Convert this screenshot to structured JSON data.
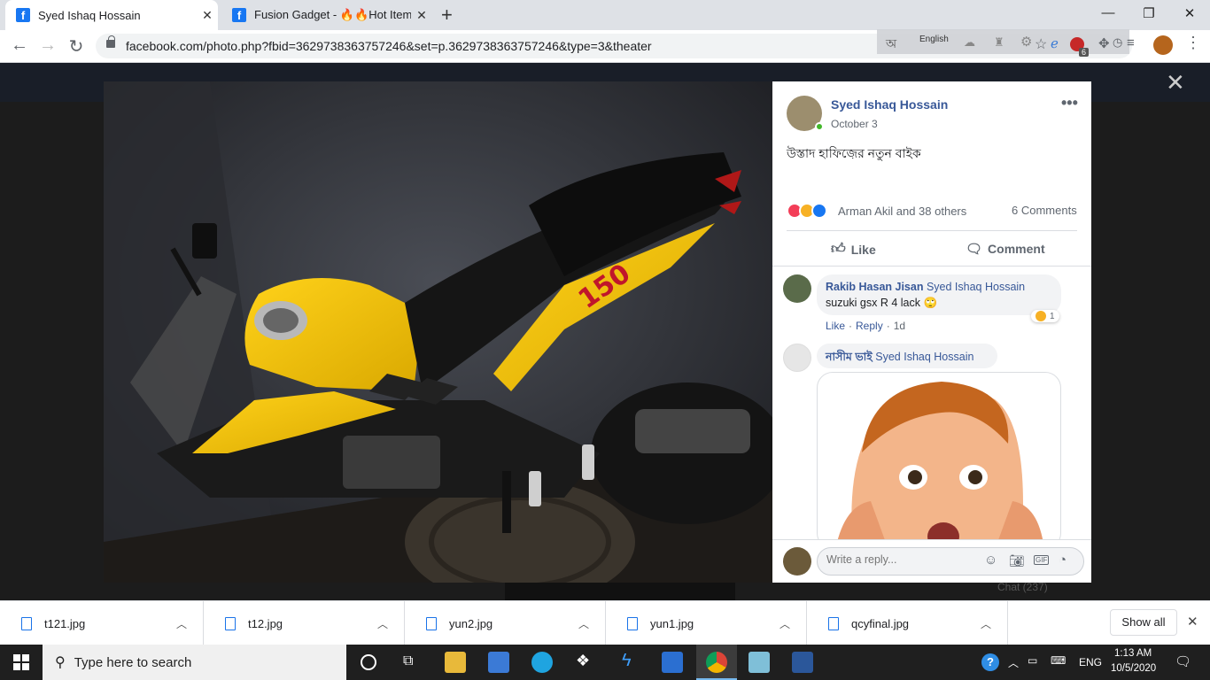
{
  "browser": {
    "tabs": [
      {
        "title": "Syed Ishaq Hossain",
        "active": true
      },
      {
        "title": "Fusion Gadget - 🔥🔥Hot Item🔥(",
        "active": false
      }
    ],
    "url": "facebook.com/photo.php?fbid=3629738363757246&set=p.3629738363757246&type=3&theater",
    "ime_language": "English",
    "badge_count": "6"
  },
  "post": {
    "author": "Syed Ishaq Hossain",
    "date": "October 3",
    "caption": "উস্তাদ হাফিজ়ের নতুন বাইক",
    "reactions_text": "Arman Akil and 38 others",
    "comments_count": "6 Comments",
    "like_label": "Like",
    "comment_label": "Comment",
    "bike_badge_text": "150"
  },
  "comments": [
    {
      "author": "Rakib Hasan Jisan",
      "tag": "Syed Ishaq Hossain",
      "text": "suzuki gsx R 4 lack 🙄",
      "reaction_count": "1",
      "like": "Like",
      "reply": "Reply",
      "age": "1d"
    },
    {
      "author": "নাসীম ভাই",
      "tag": "Syed Ishaq Hossain"
    }
  ],
  "reply_box": {
    "placeholder": "Write a reply..."
  },
  "chat_hint": "Chat (237)",
  "downloads": {
    "files": [
      "t121.jpg",
      "t12.jpg",
      "yun2.jpg",
      "yun1.jpg",
      "qcyfinal.jpg"
    ],
    "show_all": "Show all"
  },
  "taskbar": {
    "search_placeholder": "Type here to search",
    "language": "ENG",
    "time": "1:13 AM",
    "date": "10/5/2020"
  },
  "colors": {
    "facebook_blue": "#385898",
    "bike_yellow": "#f2c200",
    "taskbar": "#1f1f1f"
  }
}
